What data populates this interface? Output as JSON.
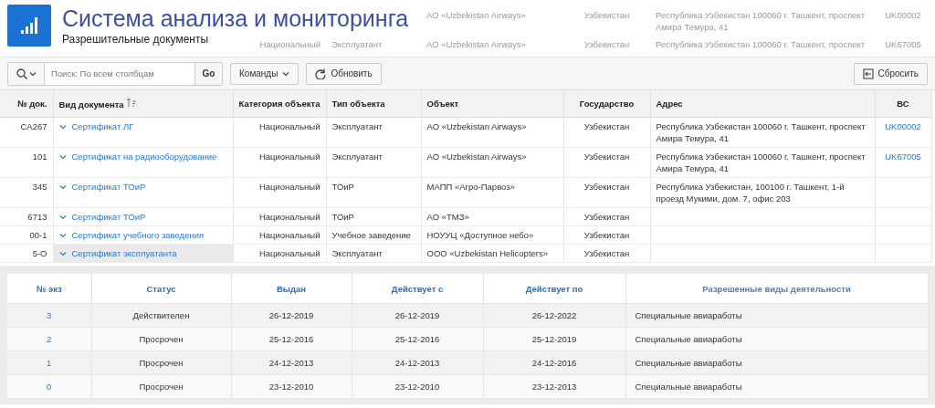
{
  "app": {
    "title": "Система анализа и мониторинга",
    "subtitle": "Разрешительные документы"
  },
  "background_rows": [
    {
      "object": "АО «Uzbekistan Airways»",
      "state": "Узбекистан",
      "address": "Республика Узбекистан 100060 г. Ташкент, проспект Амира Темура, 41",
      "aircraft": "UK00002"
    },
    {
      "category": "Национальный",
      "type": "Эксплуатант",
      "object": "АО «Uzbekistan Airways»",
      "state": "Узбекистан",
      "address": "Республика Узбекистан 100060 г. Ташкент, проспект",
      "aircraft": "UK67005"
    }
  ],
  "toolbar": {
    "search_placeholder": "Поиск: По всем столбцам",
    "go": "Go",
    "commands": "Команды",
    "refresh": "Обновить",
    "reset": "Сбросить"
  },
  "table": {
    "columns": [
      {
        "label": "№ док.",
        "sorted": false
      },
      {
        "label": "Вид документа",
        "sorted": true
      },
      {
        "label": "Категория объекта",
        "sorted": false
      },
      {
        "label": "Тип объекта",
        "sorted": false
      },
      {
        "label": "Объект",
        "sorted": false
      },
      {
        "label": "Государство",
        "sorted": false
      },
      {
        "label": "Адрес",
        "sorted": false
      },
      {
        "label": "ВС",
        "sorted": false
      }
    ],
    "rows": [
      {
        "number": "CA267",
        "doc_type": "Сертификат ЛГ",
        "category": "Национальный",
        "type": "Эксплуатант",
        "object": "АО «Uzbekistan Airways»",
        "state": "Узбекистан",
        "address": "Республика Узбекистан 100060 г. Ташкент, проспект Амира Темура, 41",
        "aircraft": "UK00002",
        "selected": false
      },
      {
        "number": "101",
        "doc_type": "Сертификат на радиооборудование",
        "category": "Национальный",
        "type": "Эксплуатант",
        "object": "АО «Uzbekistan Airways»",
        "state": "Узбекистан",
        "address": "Республика Узбекистан 100060 г. Ташкент, проспект Амира Темура, 41",
        "aircraft": "UK67005",
        "selected": false
      },
      {
        "number": "345",
        "doc_type": "Сертификат ТОиР",
        "category": "Национальный",
        "type": "ТОиР",
        "object": "МАПП «Агро-Парвоз»",
        "state": "Узбекистан",
        "address": "Республика Узбекистан, 100100 г. Ташкент, 1-й проезд Мукими, дом. 7, офис 203",
        "selected": false
      },
      {
        "number": "6713",
        "doc_type": "Сертификат ТОиР",
        "category": "Национальный",
        "type": "ТОиР",
        "object": "АО «ТМЗ»",
        "state": "Узбекистан",
        "selected": false
      },
      {
        "number": "00-1",
        "doc_type": "Сертификат учебного заведения",
        "category": "Национальный",
        "type": "Учебное заведение",
        "object": "НОУУЦ «Доступное небо»",
        "state": "Узбекистан",
        "selected": false
      },
      {
        "number": "5-O",
        "doc_type": "Сертификат эксплуатанта",
        "category": "Национальный",
        "type": "Эксплуатант",
        "object": "ООО «Uzbekistan Helicopters»",
        "state": "Узбекистан",
        "selected": true
      }
    ]
  },
  "detail": {
    "columns": [
      "№ экз",
      "Статус",
      "Выдан",
      "Действует с",
      "Действует по",
      "Разрешенные виды деятельности"
    ],
    "rows": [
      {
        "copy": "3",
        "status": "Действителен",
        "issued": "26-12-2019",
        "valid_from": "26-12-2019",
        "valid_to": "26-12-2022",
        "activities": "Специальные авиаработы"
      },
      {
        "copy": "2",
        "status": "Просрочен",
        "issued": "25-12-2016",
        "valid_from": "25-12-2016",
        "valid_to": "25-12-2019",
        "activities": "Специальные авиаработы"
      },
      {
        "copy": "1",
        "status": "Просрочен",
        "issued": "24-12-2013",
        "valid_from": "24-12-2013",
        "valid_to": "24-12-2016",
        "activities": "Специальные авиаработы"
      },
      {
        "copy": "0",
        "status": "Просрочен",
        "issued": "23-12-2010",
        "valid_from": "23-12-2010",
        "valid_to": "23-12-2013",
        "activities": "Специальные авиаработы"
      }
    ]
  }
}
